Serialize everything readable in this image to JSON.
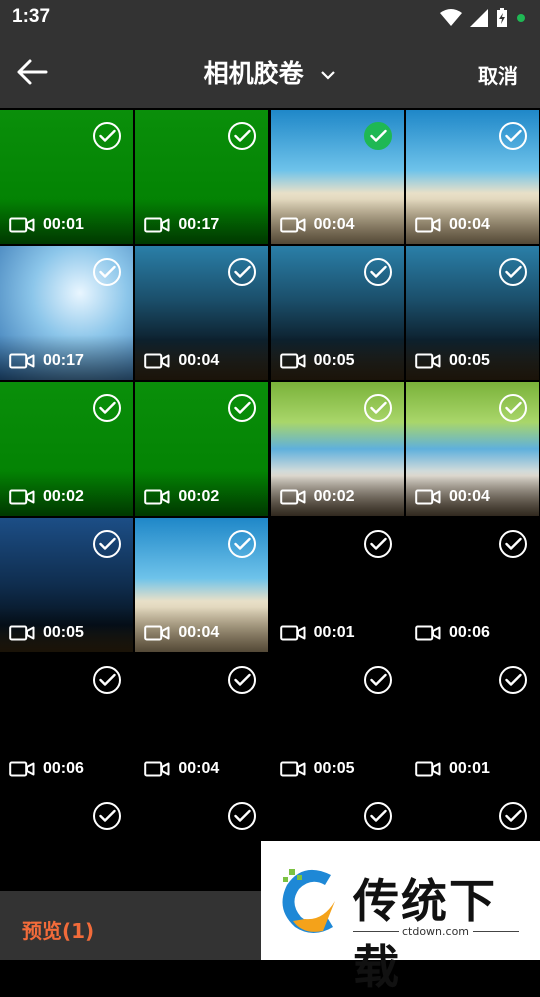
{
  "status": {
    "time": "1:37"
  },
  "header": {
    "title": "相机胶卷",
    "cancel": "取消"
  },
  "tiles": [
    {
      "duration": "00:01",
      "selected": false,
      "theme": "green"
    },
    {
      "duration": "00:17",
      "selected": false,
      "theme": "green"
    },
    {
      "duration": "00:04",
      "selected": true,
      "theme": "beach"
    },
    {
      "duration": "00:04",
      "selected": false,
      "theme": "beach"
    },
    {
      "duration": "00:17",
      "selected": false,
      "theme": "ice"
    },
    {
      "duration": "00:04",
      "selected": false,
      "theme": "forest"
    },
    {
      "duration": "00:05",
      "selected": false,
      "theme": "forest"
    },
    {
      "duration": "00:05",
      "selected": false,
      "theme": "forest"
    },
    {
      "duration": "00:02",
      "selected": false,
      "theme": "green"
    },
    {
      "duration": "00:02",
      "selected": false,
      "theme": "green"
    },
    {
      "duration": "00:02",
      "selected": false,
      "theme": "dog"
    },
    {
      "duration": "00:04",
      "selected": false,
      "theme": "dog"
    },
    {
      "duration": "00:05",
      "selected": false,
      "theme": "stars"
    },
    {
      "duration": "00:04",
      "selected": false,
      "theme": "beach"
    },
    {
      "duration": "00:01",
      "selected": false,
      "theme": "black"
    },
    {
      "duration": "00:06",
      "selected": false,
      "theme": "black"
    },
    {
      "duration": "00:06",
      "selected": false,
      "theme": "black"
    },
    {
      "duration": "00:04",
      "selected": false,
      "theme": "black"
    },
    {
      "duration": "00:05",
      "selected": false,
      "theme": "black"
    },
    {
      "duration": "00:01",
      "selected": false,
      "theme": "black"
    },
    {
      "duration": "",
      "selected": false,
      "theme": "black"
    },
    {
      "duration": "",
      "selected": false,
      "theme": "black"
    },
    {
      "duration": "",
      "selected": false,
      "theme": "black"
    },
    {
      "duration": "",
      "selected": false,
      "theme": "black"
    }
  ],
  "bottom": {
    "preview": "预览(1)"
  },
  "watermark": {
    "brand": "传统下载",
    "url": "ctdown.com"
  },
  "colors": {
    "bar": "#333333",
    "accent": "#f26b3a",
    "selected": "#1fb854",
    "green_tile": "#008a00"
  },
  "icons": [
    "back-arrow-icon",
    "chevron-down-icon",
    "video-camera-icon",
    "check-circle-icon",
    "wifi-icon",
    "signal-icon",
    "battery-charging-icon"
  ]
}
